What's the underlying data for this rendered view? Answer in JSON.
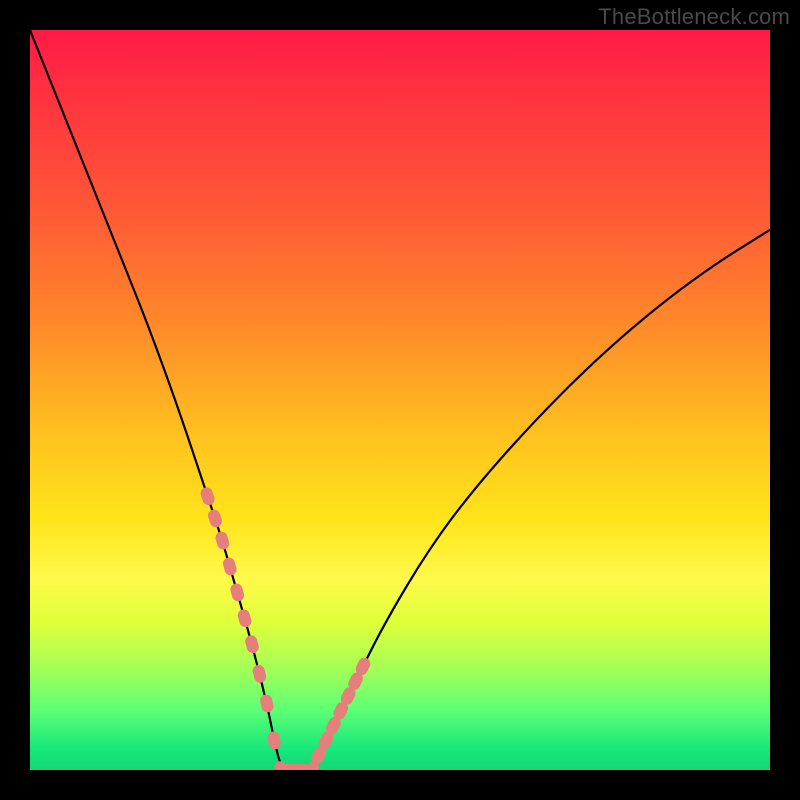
{
  "watermark": {
    "text": "TheBottleneck.com"
  },
  "colors": {
    "frame": "#000000",
    "curve": "#000000",
    "marker": "#e47f7c",
    "gradient_stops": [
      "#ff1a46",
      "#ff5a36",
      "#ffc21f",
      "#fff94a",
      "#5cff75",
      "#12d876"
    ]
  },
  "chart_data": {
    "type": "line",
    "title": "",
    "xlabel": "",
    "ylabel": "",
    "xlim": [
      0,
      100
    ],
    "ylim": [
      0,
      100
    ],
    "grid": false,
    "legend": false,
    "series": [
      {
        "name": "bottleneck-curve",
        "x": [
          0,
          4,
          8,
          12,
          16,
          20,
          24,
          26,
          28,
          30,
          32,
          33,
          34,
          36,
          38,
          40,
          44,
          48,
          54,
          60,
          68,
          76,
          84,
          92,
          100
        ],
        "y": [
          100,
          90,
          80,
          70,
          60,
          49,
          37,
          31,
          24,
          17,
          9,
          4,
          0,
          0,
          0,
          4,
          12,
          20,
          30,
          38,
          47,
          55,
          62,
          68,
          73
        ]
      }
    ],
    "markers": {
      "name": "highlighted-points",
      "color": "#e47f7c",
      "x": [
        24,
        25,
        26,
        27,
        28,
        29,
        30,
        31,
        32,
        33,
        34,
        35,
        36,
        37,
        38,
        39,
        40,
        41,
        42,
        43,
        44,
        45
      ],
      "y": [
        37,
        34,
        31,
        27.5,
        24,
        20.5,
        17,
        13,
        9,
        4,
        0,
        0,
        0,
        0,
        0,
        2,
        4,
        6,
        8,
        10,
        12,
        14
      ]
    },
    "note": "x and y are normalized 0–100 across the inner plot area; y increases upward. Values are visually estimated (no axis labels present)."
  }
}
